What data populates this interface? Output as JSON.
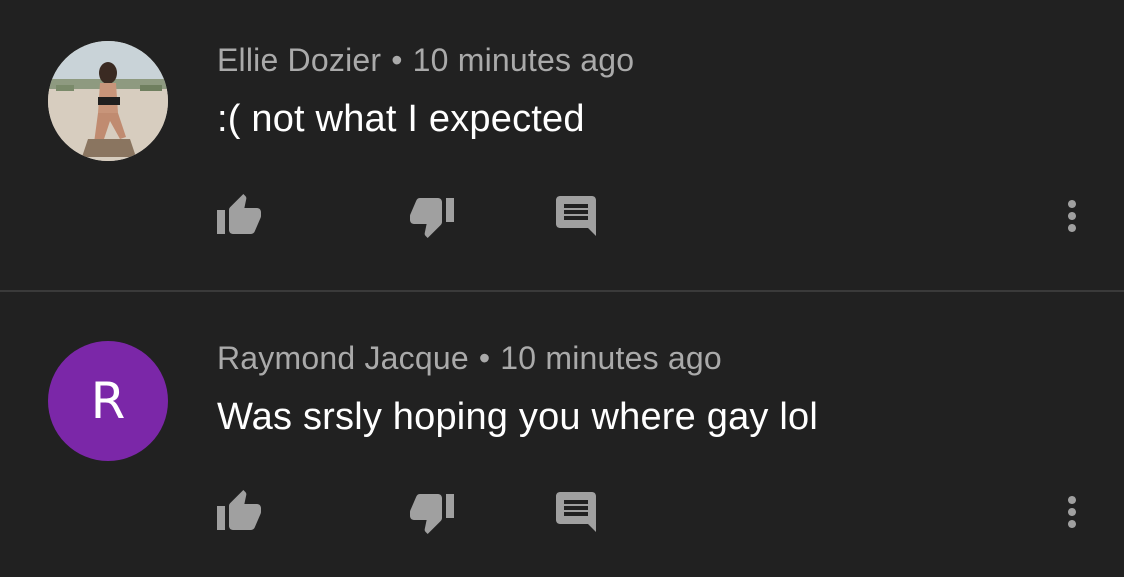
{
  "colors": {
    "background": "#212121",
    "divider": "#3a3a3a",
    "meta_text": "#aaaaaa",
    "comment_text": "#ffffff",
    "icon": "#a0a0a0",
    "avatar_purple": "#7b27a8"
  },
  "comments": [
    {
      "author": "Ellie Dozier",
      "separator": "•",
      "time": "10 minutes ago",
      "text": ":( not what I expected",
      "avatar": {
        "type": "photo"
      },
      "actions": [
        "thumb-up-icon",
        "thumb-down-icon",
        "reply-icon",
        "more-vert-icon"
      ]
    },
    {
      "author": "Raymond Jacque",
      "separator": "•",
      "time": "10 minutes ago",
      "text": "Was srsly hoping you where gay lol",
      "avatar": {
        "type": "letter",
        "letter": "R",
        "color": "#7b27a8"
      },
      "actions": [
        "thumb-up-icon",
        "thumb-down-icon",
        "reply-icon",
        "more-vert-icon"
      ]
    }
  ]
}
